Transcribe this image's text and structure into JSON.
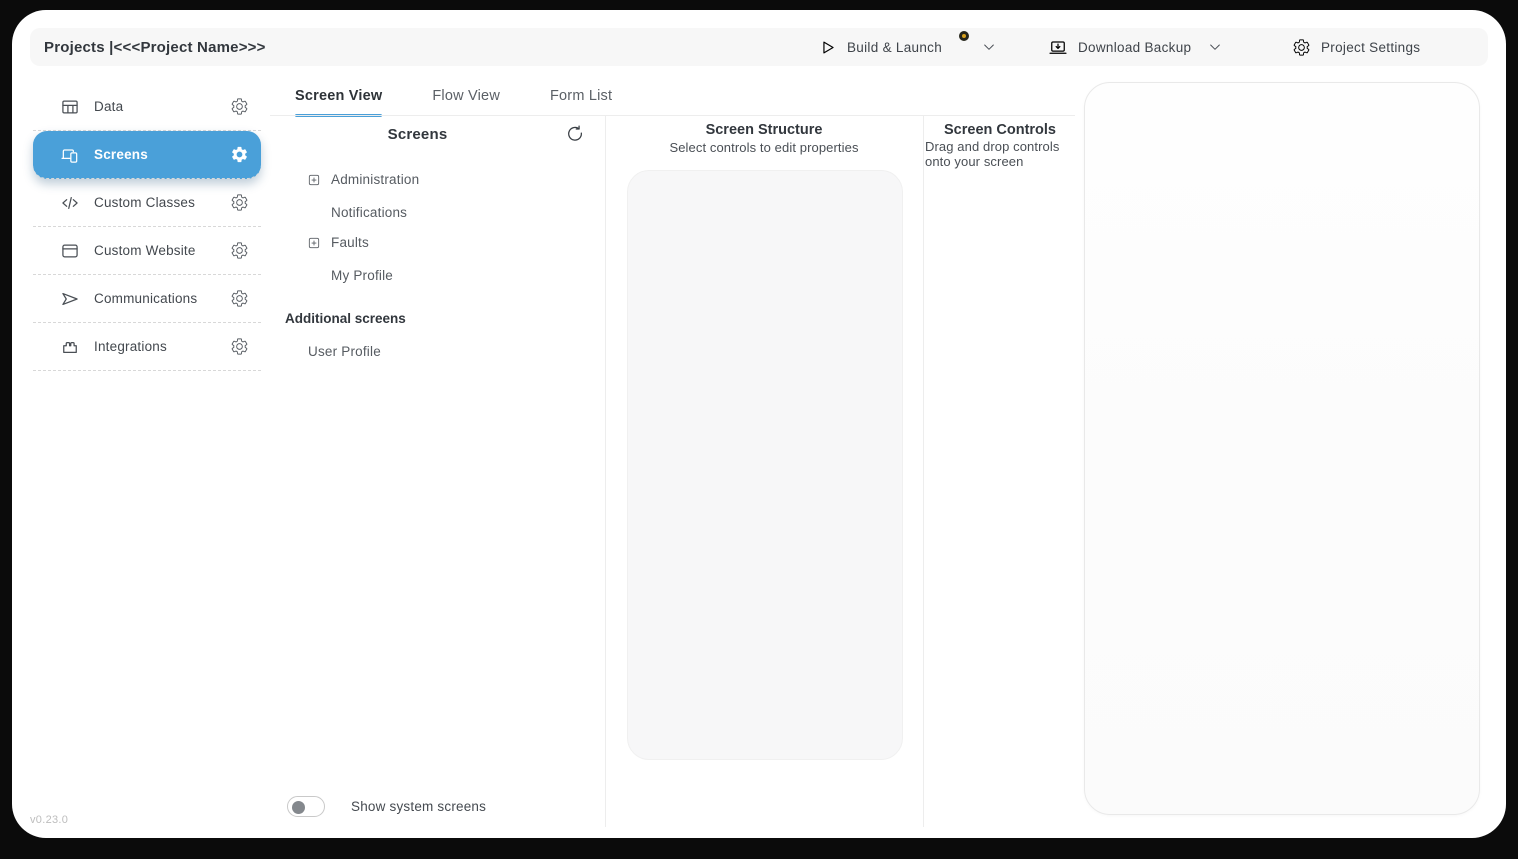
{
  "colors": {
    "accent": "#4AA0D9",
    "badge": "#D7A11F"
  },
  "topbar": {
    "title": "Projects |<<<Project Name>>>",
    "build_launch_label": "Build & Launch",
    "download_backup_label": "Download Backup",
    "project_settings_label": "Project Settings"
  },
  "sidebar": {
    "items": [
      {
        "label": "Data",
        "icon": "table-icon",
        "active": false
      },
      {
        "label": "Screens",
        "icon": "devices-icon",
        "active": true
      },
      {
        "label": "Custom Classes",
        "icon": "code-icon",
        "active": false
      },
      {
        "label": "Custom Website",
        "icon": "browser-icon",
        "active": false
      },
      {
        "label": "Communications",
        "icon": "send-icon",
        "active": false
      },
      {
        "label": "Integrations",
        "icon": "brick-icon",
        "active": false
      }
    ]
  },
  "tabs": {
    "items": [
      {
        "label": "Screen View",
        "active": true
      },
      {
        "label": "Flow View",
        "active": false
      },
      {
        "label": "Form List",
        "active": false
      }
    ]
  },
  "screens_panel": {
    "title": "Screens",
    "tree": [
      {
        "label": "Administration",
        "expandable": true
      },
      {
        "label": "Notifications",
        "expandable": false
      },
      {
        "label": "Faults",
        "expandable": true
      },
      {
        "label": "My Profile",
        "expandable": false
      }
    ],
    "additional_header": "Additional screens",
    "additional_items": [
      {
        "label": "User Profile"
      }
    ],
    "show_system_label": "Show system screens",
    "toggle_state": "off"
  },
  "structure_panel": {
    "title": "Screen Structure",
    "subtitle": "Select controls to edit properties"
  },
  "controls_panel": {
    "title": "Screen Controls",
    "subtitle": "Drag and drop controls onto your screen"
  },
  "footer": {
    "version": "v0.23.0"
  }
}
